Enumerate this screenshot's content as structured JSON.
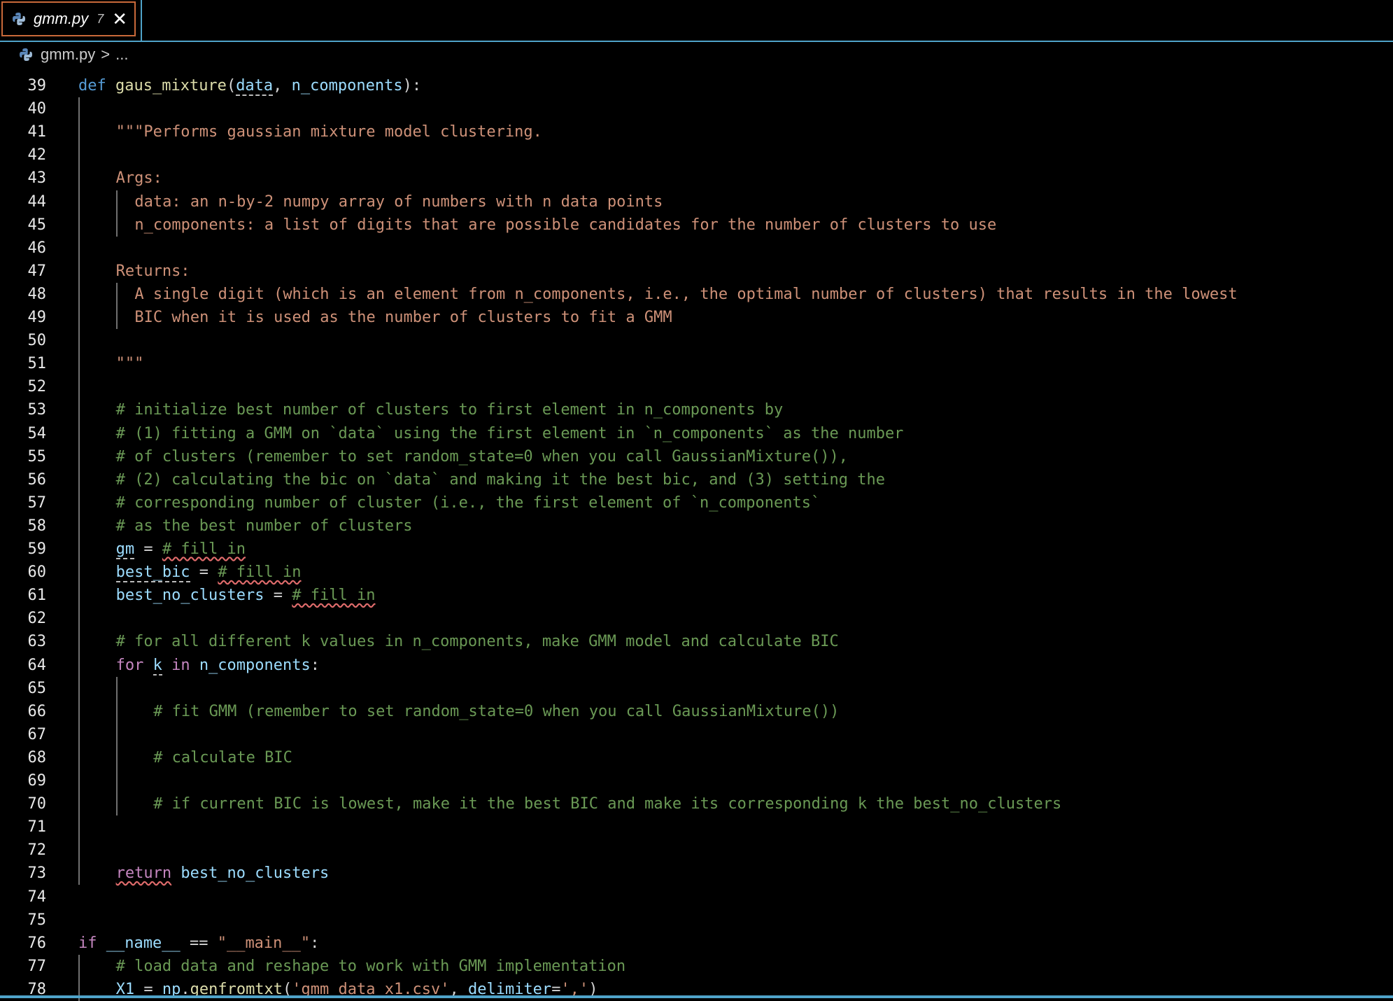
{
  "tab": {
    "filename": "gmm.py",
    "problem_count": "7",
    "close_glyph": "✕"
  },
  "breadcrumb": {
    "file": "gmm.py",
    "separator": ">",
    "rest": "..."
  },
  "lines": [
    {
      "n": "39",
      "t": [
        [
          "kw",
          "def "
        ],
        [
          "fn",
          "gaus_mixture"
        ],
        [
          "op",
          "("
        ],
        [
          "var dotted",
          "data"
        ],
        [
          "op",
          ", "
        ],
        [
          "var",
          "n_components"
        ],
        [
          "op",
          "):"
        ]
      ],
      "i": 0
    },
    {
      "n": "40",
      "t": [],
      "i": 0
    },
    {
      "n": "41",
      "t": [
        [
          "str",
          "\"\"\"Performs gaussian mixture model clustering."
        ]
      ],
      "i": 1
    },
    {
      "n": "42",
      "t": [],
      "i": 1
    },
    {
      "n": "43",
      "t": [
        [
          "str",
          "Args:"
        ]
      ],
      "i": 1
    },
    {
      "n": "44",
      "t": [
        [
          "str",
          "data: an n-by-2 numpy array of numbers with n data points"
        ]
      ],
      "i": 1.5
    },
    {
      "n": "45",
      "t": [
        [
          "str",
          "n_components: a list of digits that are possible candidates for the number of clusters to use"
        ]
      ],
      "i": 1.5
    },
    {
      "n": "46",
      "t": [],
      "i": 1
    },
    {
      "n": "47",
      "t": [
        [
          "str",
          "Returns:"
        ]
      ],
      "i": 1
    },
    {
      "n": "48",
      "t": [
        [
          "str",
          "A single digit (which is an element from n_components, i.e., the optimal number of clusters) that results in the lowest"
        ]
      ],
      "i": 1.5
    },
    {
      "n": "49",
      "t": [
        [
          "str",
          "BIC when it is used as the number of clusters to fit a GMM"
        ]
      ],
      "i": 1.5
    },
    {
      "n": "50",
      "t": [],
      "i": 1
    },
    {
      "n": "51",
      "t": [
        [
          "str",
          "\"\"\""
        ]
      ],
      "i": 1
    },
    {
      "n": "52",
      "t": [],
      "i": 1
    },
    {
      "n": "53",
      "t": [
        [
          "cm",
          "# initialize best number of clusters to first element in n_components by"
        ]
      ],
      "i": 1
    },
    {
      "n": "54",
      "t": [
        [
          "cm",
          "# (1) fitting a GMM on `data` using the first element in `n_components` as the number"
        ]
      ],
      "i": 1
    },
    {
      "n": "55",
      "t": [
        [
          "cm",
          "# of clusters (remember to set random_state=0 when you call GaussianMixture()),"
        ]
      ],
      "i": 1
    },
    {
      "n": "56",
      "t": [
        [
          "cm",
          "# (2) calculating the bic on `data` and making it the best bic, and (3) setting the"
        ]
      ],
      "i": 1
    },
    {
      "n": "57",
      "t": [
        [
          "cm",
          "# corresponding number of cluster (i.e., the first element of `n_components`"
        ]
      ],
      "i": 1
    },
    {
      "n": "58",
      "t": [
        [
          "cm",
          "# as the best number of clusters"
        ]
      ],
      "i": 1
    },
    {
      "n": "59",
      "t": [
        [
          "var dotted",
          "gm"
        ],
        [
          "op",
          " = "
        ],
        [
          "cm squig",
          "# fill in"
        ]
      ],
      "i": 1
    },
    {
      "n": "60",
      "t": [
        [
          "var dotted",
          "best_bic"
        ],
        [
          "op",
          " = "
        ],
        [
          "cm squig",
          "# fill in"
        ]
      ],
      "i": 1
    },
    {
      "n": "61",
      "t": [
        [
          "var",
          "best_no_clusters"
        ],
        [
          "op",
          " = "
        ],
        [
          "cm squig",
          "# fill in"
        ]
      ],
      "i": 1
    },
    {
      "n": "62",
      "t": [],
      "i": 1
    },
    {
      "n": "63",
      "t": [
        [
          "cm",
          "# for all different k values in n_components, make GMM model and calculate BIC"
        ]
      ],
      "i": 1
    },
    {
      "n": "64",
      "t": [
        [
          "ctrl",
          "for "
        ],
        [
          "var dotted",
          "k"
        ],
        [
          "ctrl",
          " in "
        ],
        [
          "var",
          "n_components"
        ],
        [
          "op",
          ":"
        ]
      ],
      "i": 1
    },
    {
      "n": "65",
      "t": [],
      "i": 2
    },
    {
      "n": "66",
      "t": [
        [
          "cm",
          "# fit GMM (remember to set random_state=0 when you call GaussianMixture())"
        ]
      ],
      "i": 2
    },
    {
      "n": "67",
      "t": [],
      "i": 2
    },
    {
      "n": "68",
      "t": [
        [
          "cm",
          "# calculate BIC"
        ]
      ],
      "i": 2
    },
    {
      "n": "69",
      "t": [],
      "i": 2
    },
    {
      "n": "70",
      "t": [
        [
          "cm",
          "# if current BIC is lowest, make it the best BIC and make its corresponding k the best_no_clusters"
        ]
      ],
      "i": 2
    },
    {
      "n": "71",
      "t": [],
      "i": 1
    },
    {
      "n": "72",
      "t": [],
      "i": 1
    },
    {
      "n": "73",
      "t": [
        [
          "ctrl squig",
          "return"
        ],
        [
          "op",
          " "
        ],
        [
          "var",
          "best_no_clusters"
        ]
      ],
      "i": 1
    },
    {
      "n": "74",
      "t": [],
      "i": 0
    },
    {
      "n": "75",
      "t": [],
      "i": 0
    },
    {
      "n": "76",
      "t": [
        [
          "ctrl",
          "if "
        ],
        [
          "var",
          "__name__"
        ],
        [
          "op",
          " == "
        ],
        [
          "str",
          "\"__main__\""
        ],
        [
          "op",
          ":"
        ]
      ],
      "i": 0
    },
    {
      "n": "77",
      "t": [
        [
          "cm",
          "# load data and reshape to work with GMM implementation"
        ]
      ],
      "i": 1
    },
    {
      "n": "78",
      "t": [
        [
          "var",
          "X1"
        ],
        [
          "op",
          " = "
        ],
        [
          "var",
          "np"
        ],
        [
          "op",
          "."
        ],
        [
          "fn",
          "genfromtxt"
        ],
        [
          "op",
          "("
        ],
        [
          "str",
          "'gmm_data_x1.csv'"
        ],
        [
          "op",
          ", "
        ],
        [
          "var",
          "delimiter"
        ],
        [
          "op",
          "="
        ],
        [
          "str",
          "','"
        ],
        [
          "op",
          ")"
        ]
      ],
      "i": 1
    }
  ]
}
